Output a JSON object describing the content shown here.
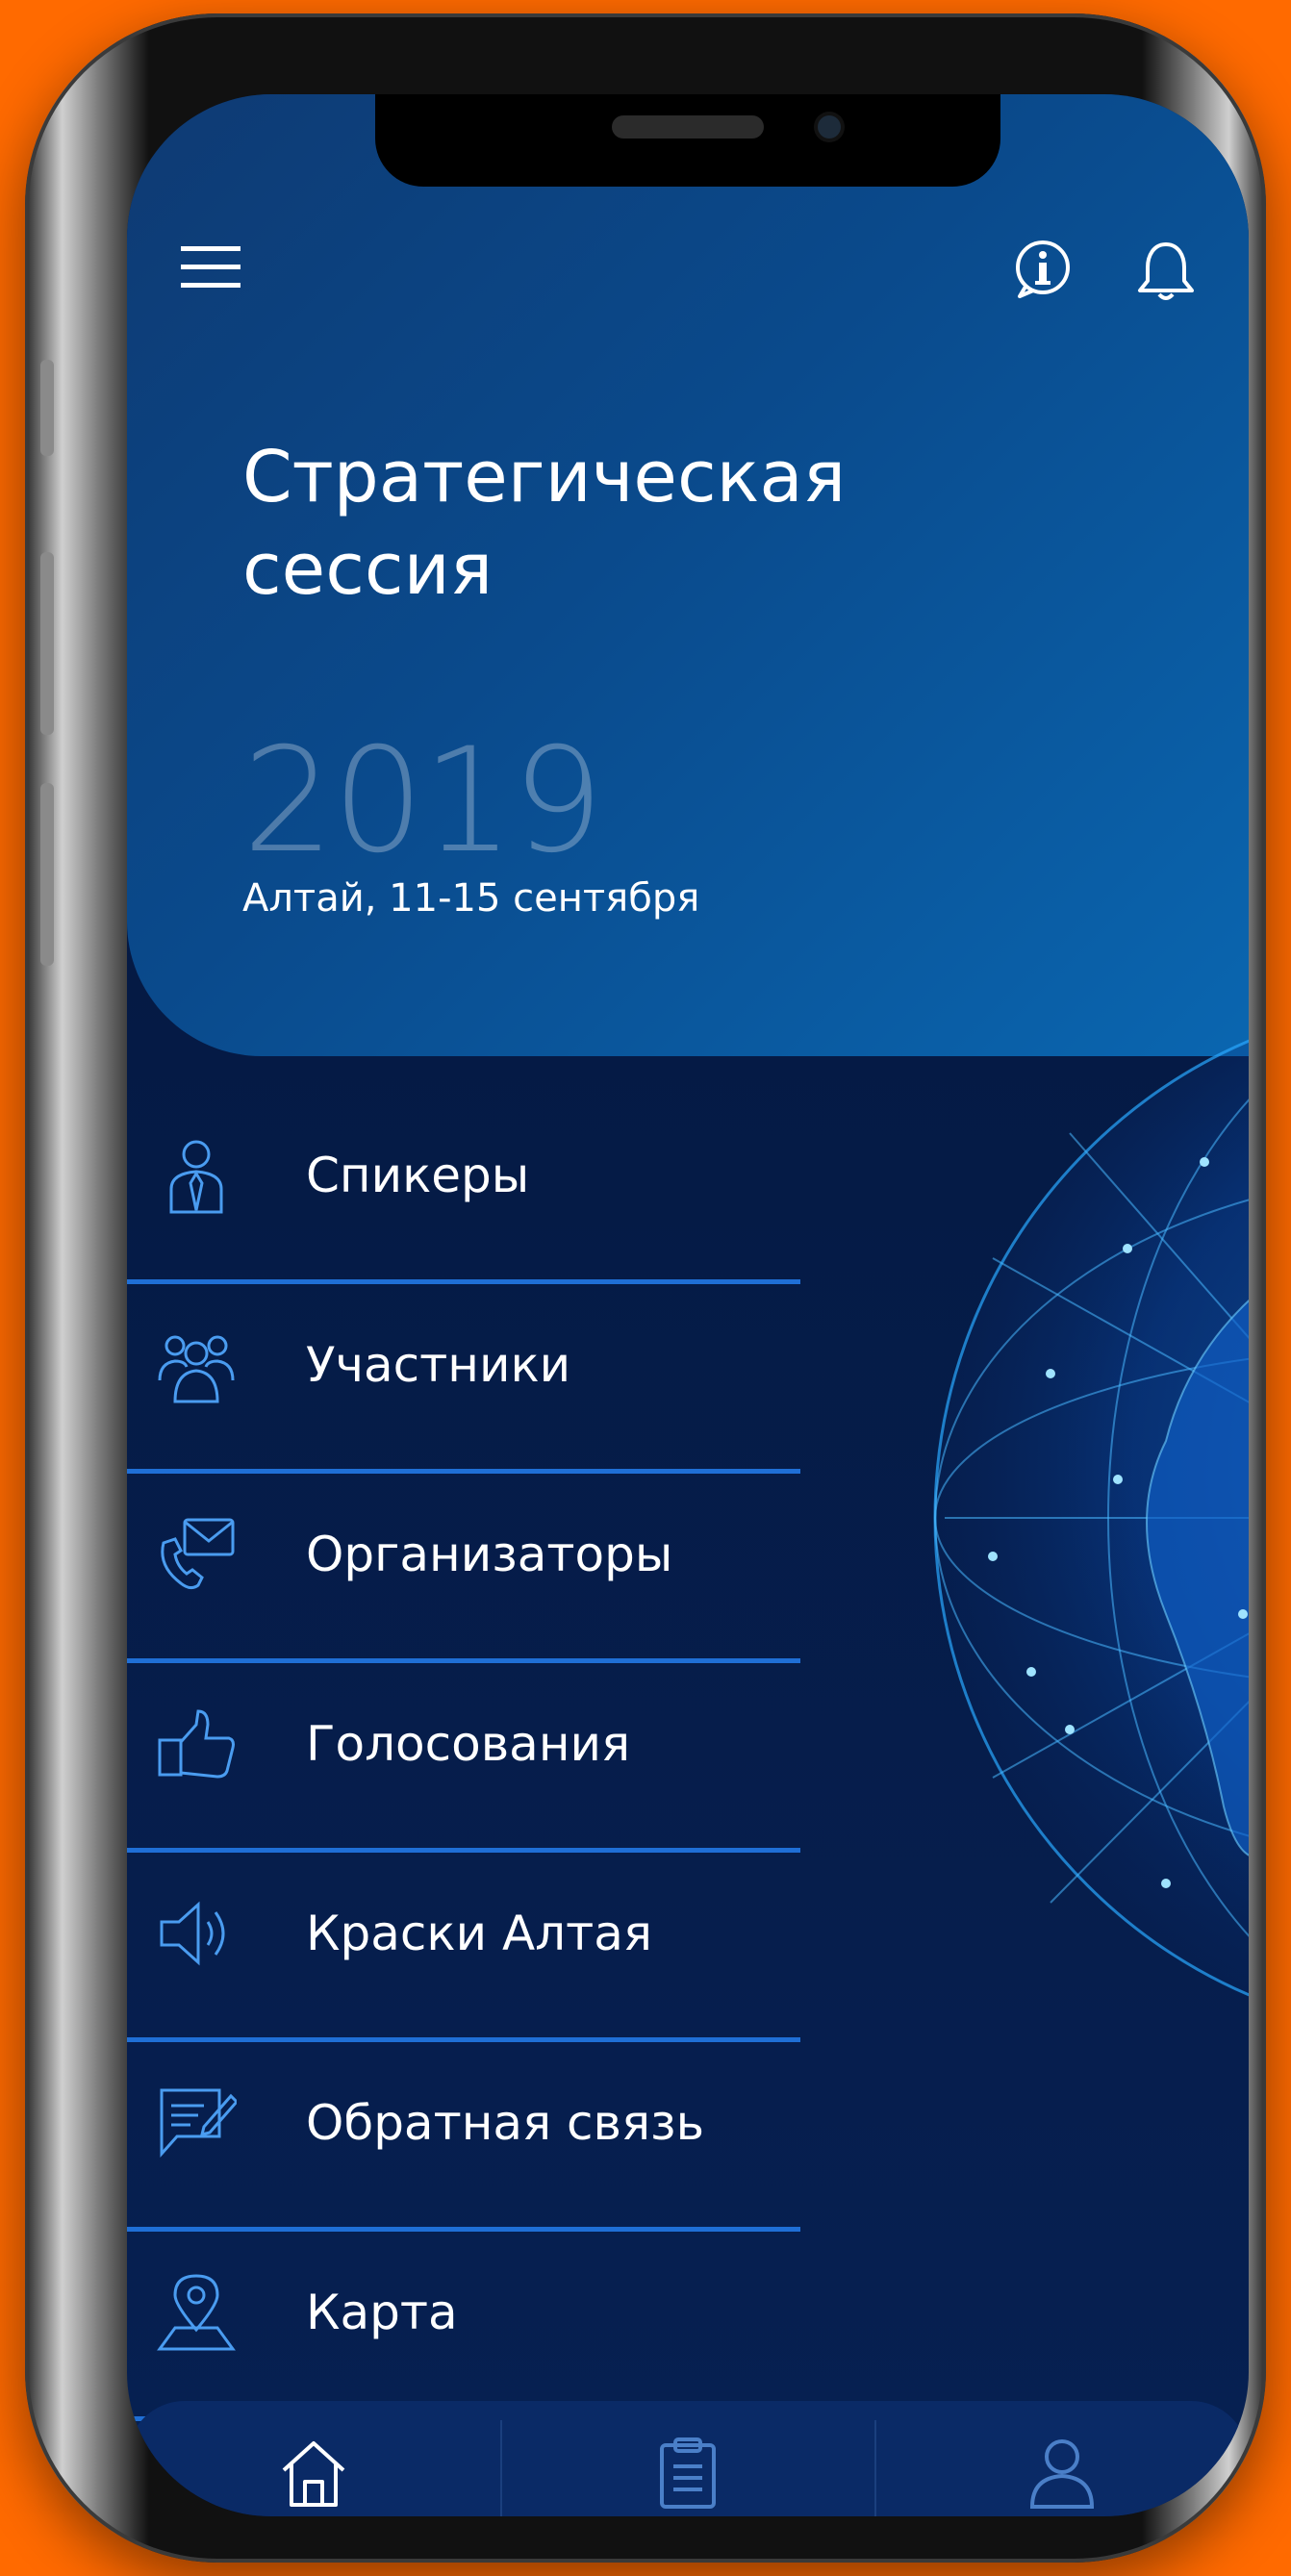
{
  "header": {
    "title": "Стратегическая сессия",
    "year": "2019",
    "subtitle": "Алтай, 11-15 сентября"
  },
  "icons": {
    "menu": "hamburger-menu-icon",
    "info": "info-icon",
    "notifications": "bell-icon"
  },
  "menu": {
    "items": [
      {
        "label": "Спикеры",
        "icon": "speaker-person-icon"
      },
      {
        "label": "Участники",
        "icon": "group-icon"
      },
      {
        "label": "Организаторы",
        "icon": "phone-mail-icon"
      },
      {
        "label": "Голосования",
        "icon": "thumbs-up-icon"
      },
      {
        "label": "Краски Алтая",
        "icon": "megaphone-icon"
      },
      {
        "label": "Обратная связь",
        "icon": "feedback-icon"
      },
      {
        "label": "Карта",
        "icon": "map-pin-icon"
      }
    ]
  },
  "tabbar": {
    "tabs": [
      {
        "name": "home",
        "icon": "home-icon"
      },
      {
        "name": "schedule",
        "icon": "clipboard-icon"
      },
      {
        "name": "profile",
        "icon": "user-icon"
      }
    ]
  },
  "colors": {
    "background": "#ff6a00",
    "screen": "#051a44",
    "accent_line": "#1f6fd6",
    "text": "#ffffff"
  }
}
